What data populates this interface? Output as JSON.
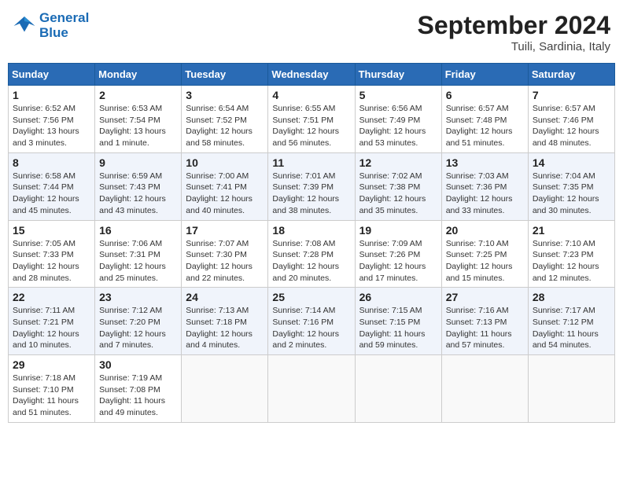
{
  "header": {
    "logo_line1": "General",
    "logo_line2": "Blue",
    "month_title": "September 2024",
    "location": "Tuili, Sardinia, Italy"
  },
  "weekdays": [
    "Sunday",
    "Monday",
    "Tuesday",
    "Wednesday",
    "Thursday",
    "Friday",
    "Saturday"
  ],
  "weeks": [
    [
      {
        "day": "1",
        "sunrise": "6:52 AM",
        "sunset": "7:56 PM",
        "daylight": "13 hours and 3 minutes."
      },
      {
        "day": "2",
        "sunrise": "6:53 AM",
        "sunset": "7:54 PM",
        "daylight": "13 hours and 1 minute."
      },
      {
        "day": "3",
        "sunrise": "6:54 AM",
        "sunset": "7:52 PM",
        "daylight": "12 hours and 58 minutes."
      },
      {
        "day": "4",
        "sunrise": "6:55 AM",
        "sunset": "7:51 PM",
        "daylight": "12 hours and 56 minutes."
      },
      {
        "day": "5",
        "sunrise": "6:56 AM",
        "sunset": "7:49 PM",
        "daylight": "12 hours and 53 minutes."
      },
      {
        "day": "6",
        "sunrise": "6:57 AM",
        "sunset": "7:48 PM",
        "daylight": "12 hours and 51 minutes."
      },
      {
        "day": "7",
        "sunrise": "6:57 AM",
        "sunset": "7:46 PM",
        "daylight": "12 hours and 48 minutes."
      }
    ],
    [
      {
        "day": "8",
        "sunrise": "6:58 AM",
        "sunset": "7:44 PM",
        "daylight": "12 hours and 45 minutes."
      },
      {
        "day": "9",
        "sunrise": "6:59 AM",
        "sunset": "7:43 PM",
        "daylight": "12 hours and 43 minutes."
      },
      {
        "day": "10",
        "sunrise": "7:00 AM",
        "sunset": "7:41 PM",
        "daylight": "12 hours and 40 minutes."
      },
      {
        "day": "11",
        "sunrise": "7:01 AM",
        "sunset": "7:39 PM",
        "daylight": "12 hours and 38 minutes."
      },
      {
        "day": "12",
        "sunrise": "7:02 AM",
        "sunset": "7:38 PM",
        "daylight": "12 hours and 35 minutes."
      },
      {
        "day": "13",
        "sunrise": "7:03 AM",
        "sunset": "7:36 PM",
        "daylight": "12 hours and 33 minutes."
      },
      {
        "day": "14",
        "sunrise": "7:04 AM",
        "sunset": "7:35 PM",
        "daylight": "12 hours and 30 minutes."
      }
    ],
    [
      {
        "day": "15",
        "sunrise": "7:05 AM",
        "sunset": "7:33 PM",
        "daylight": "12 hours and 28 minutes."
      },
      {
        "day": "16",
        "sunrise": "7:06 AM",
        "sunset": "7:31 PM",
        "daylight": "12 hours and 25 minutes."
      },
      {
        "day": "17",
        "sunrise": "7:07 AM",
        "sunset": "7:30 PM",
        "daylight": "12 hours and 22 minutes."
      },
      {
        "day": "18",
        "sunrise": "7:08 AM",
        "sunset": "7:28 PM",
        "daylight": "12 hours and 20 minutes."
      },
      {
        "day": "19",
        "sunrise": "7:09 AM",
        "sunset": "7:26 PM",
        "daylight": "12 hours and 17 minutes."
      },
      {
        "day": "20",
        "sunrise": "7:10 AM",
        "sunset": "7:25 PM",
        "daylight": "12 hours and 15 minutes."
      },
      {
        "day": "21",
        "sunrise": "7:10 AM",
        "sunset": "7:23 PM",
        "daylight": "12 hours and 12 minutes."
      }
    ],
    [
      {
        "day": "22",
        "sunrise": "7:11 AM",
        "sunset": "7:21 PM",
        "daylight": "12 hours and 10 minutes."
      },
      {
        "day": "23",
        "sunrise": "7:12 AM",
        "sunset": "7:20 PM",
        "daylight": "12 hours and 7 minutes."
      },
      {
        "day": "24",
        "sunrise": "7:13 AM",
        "sunset": "7:18 PM",
        "daylight": "12 hours and 4 minutes."
      },
      {
        "day": "25",
        "sunrise": "7:14 AM",
        "sunset": "7:16 PM",
        "daylight": "12 hours and 2 minutes."
      },
      {
        "day": "26",
        "sunrise": "7:15 AM",
        "sunset": "7:15 PM",
        "daylight": "11 hours and 59 minutes."
      },
      {
        "day": "27",
        "sunrise": "7:16 AM",
        "sunset": "7:13 PM",
        "daylight": "11 hours and 57 minutes."
      },
      {
        "day": "28",
        "sunrise": "7:17 AM",
        "sunset": "7:12 PM",
        "daylight": "11 hours and 54 minutes."
      }
    ],
    [
      {
        "day": "29",
        "sunrise": "7:18 AM",
        "sunset": "7:10 PM",
        "daylight": "11 hours and 51 minutes."
      },
      {
        "day": "30",
        "sunrise": "7:19 AM",
        "sunset": "7:08 PM",
        "daylight": "11 hours and 49 minutes."
      },
      null,
      null,
      null,
      null,
      null
    ]
  ],
  "labels": {
    "sunrise_prefix": "Sunrise: ",
    "sunset_prefix": "Sunset: ",
    "daylight_prefix": "Daylight: "
  }
}
